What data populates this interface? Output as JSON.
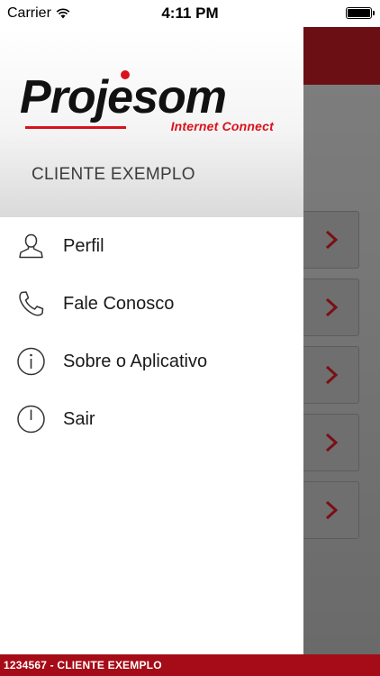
{
  "status_bar": {
    "carrier": "Carrier",
    "time": "4:11 PM",
    "battery_level": 1.0
  },
  "drawer": {
    "logo": {
      "brand": "Projesom",
      "tagline": "Internet Connect"
    },
    "client_name": "CLIENTE EXEMPLO",
    "menu_items": [
      {
        "label": "Perfil",
        "icon": "user-icon"
      },
      {
        "label": "Fale Conosco",
        "icon": "phone-icon"
      },
      {
        "label": "Sobre o Aplicativo",
        "icon": "info-icon"
      },
      {
        "label": "Sair",
        "icon": "power-icon"
      }
    ]
  },
  "background": {
    "card_chevron_icon": "chevron-right-icon",
    "card_count": 5
  },
  "bottom_bar": {
    "text": "1234567 - CLIENTE EXEMPLO"
  },
  "colors": {
    "brand_red": "#d9111b",
    "header_dark_red": "#6b0f14",
    "bottom_bar_red": "#a50c17",
    "chevron": "#7a0f15"
  }
}
